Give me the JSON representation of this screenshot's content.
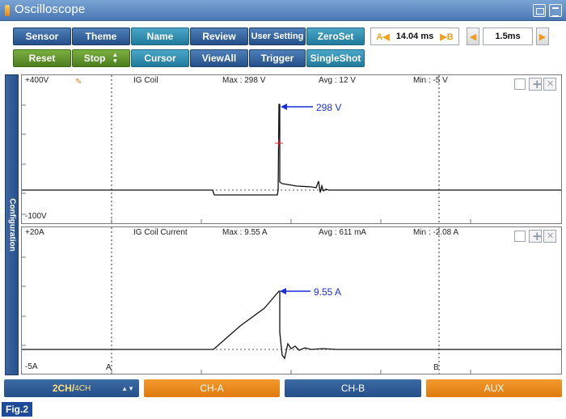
{
  "window": {
    "title": "Oscilloscope"
  },
  "toolbar": {
    "row1": [
      "Sensor",
      "Theme",
      "Name",
      "Review",
      "User Setting",
      "ZeroSet"
    ],
    "row2": [
      "Reset",
      "Stop",
      "Cursor",
      "ViewAll",
      "Trigger",
      "SingleShot"
    ],
    "cursor_a_label": "A◀",
    "cursor_b_label": "▶B",
    "cursor_delta": "14.04 ms",
    "timebase": "1.5ms"
  },
  "side_tab": {
    "label": "Configuration"
  },
  "channels": [
    {
      "scale_max": "+400V",
      "scale_min": "-100V",
      "name": "IG Coil",
      "max": "Max : 298 V",
      "avg": "Avg : 12 V",
      "min": "Min : -5 V",
      "annotation": "298 V"
    },
    {
      "scale_max": "+20A",
      "scale_min": "-5A",
      "name": "IG Coil Current",
      "max": "Max : 9.55 A",
      "avg": "Avg : 611 mA",
      "min": "Min : -2.08 A",
      "annotation": "9.55 A"
    }
  ],
  "cursors": {
    "a": "A",
    "b": "B"
  },
  "channel_tabs": {
    "select_main": "2CH",
    "select_sep": "/",
    "select_sub": "4CH",
    "tabs": [
      "CH-A",
      "CH-B",
      "AUX"
    ]
  },
  "figure_label": "Fig.2",
  "colors": {
    "title_bar": "#5a86bf",
    "button_blue": "#2f5f9c",
    "button_teal": "#2a8fb3",
    "button_green": "#5e9128",
    "tab_orange": "#eb8a1f",
    "annotation_blue": "#1a2fd6",
    "trigger_marker": "#e03030"
  }
}
